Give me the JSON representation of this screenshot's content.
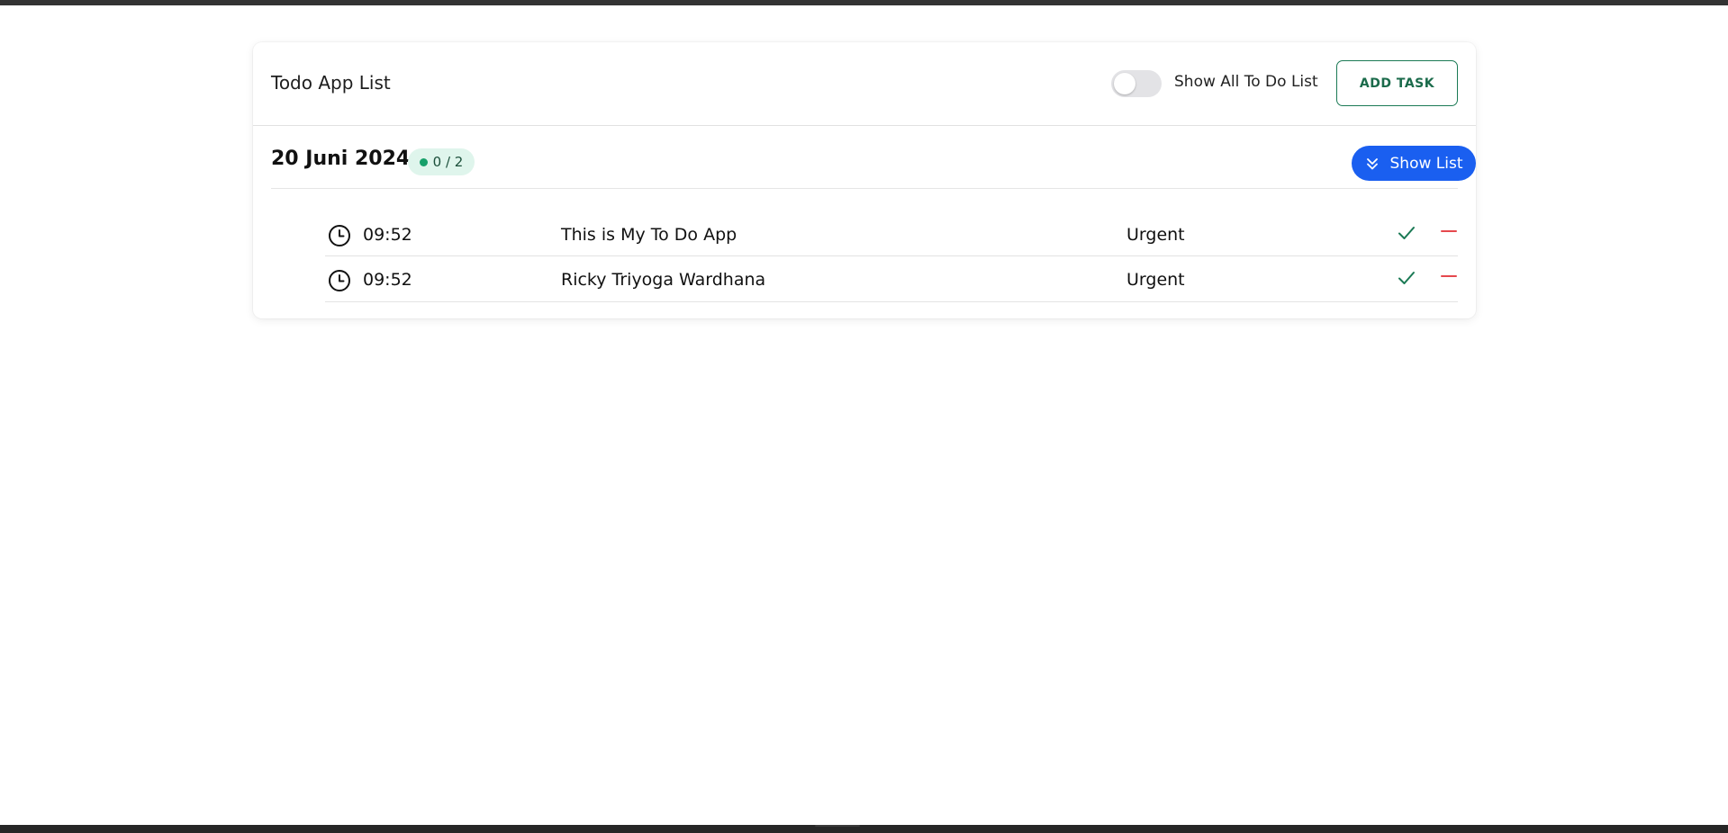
{
  "header": {
    "app_title": "Todo App List",
    "toggle_label": "Show All To Do List",
    "toggle_on": false,
    "add_task_label": "ADD TASK"
  },
  "group": {
    "date": "20 Juni 2024",
    "badge": "0 / 2",
    "show_list_label": "Show List"
  },
  "tasks": [
    {
      "time": "09:52",
      "title": "This is My To Do App",
      "priority": "Urgent"
    },
    {
      "time": "09:52",
      "title": "Ricky Triyoga Wardhana",
      "priority": "Urgent"
    }
  ],
  "colors": {
    "accent_blue": "#1a5ff0",
    "success_green": "#1b7a55",
    "danger_red": "#e5484d",
    "badge_bg": "#dff5ec"
  },
  "icons": [
    "clock-icon",
    "check-icon",
    "minus-icon",
    "chevrons-down-icon"
  ]
}
